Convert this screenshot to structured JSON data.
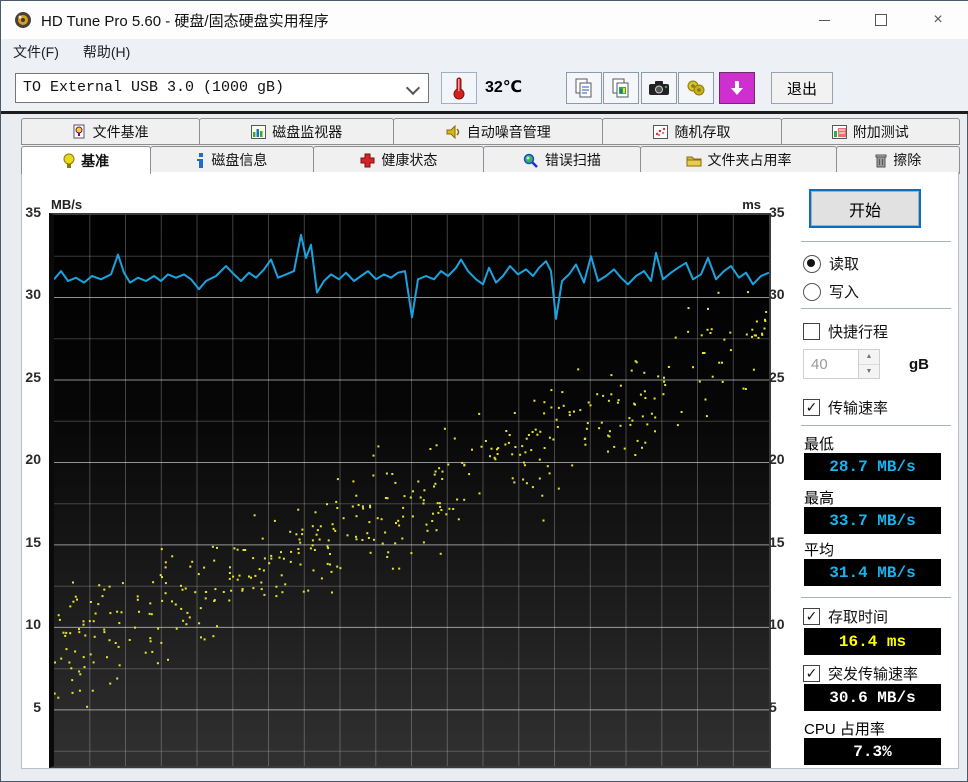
{
  "window": {
    "title": "HD Tune Pro 5.60 - 硬盘/固态硬盘实用程序",
    "controls": [
      "minimize",
      "maximize",
      "close"
    ]
  },
  "menu": {
    "items": [
      "文件(F)",
      "帮助(H)"
    ]
  },
  "toolbar": {
    "drive_select": "TO External USB 3.0 (1000 gB)",
    "temperature": "32℃",
    "buttons": [
      "copy-text-icon",
      "copy-image-icon",
      "screenshot-icon",
      "acoustic-icon",
      "save-results-icon"
    ],
    "exit_label": "退出"
  },
  "tabs": {
    "row1": [
      {
        "label": "文件基准",
        "icon": "file-benchmark-icon"
      },
      {
        "label": "磁盘监视器",
        "icon": "disk-monitor-icon"
      },
      {
        "label": "自动噪音管理",
        "icon": "acoustic-management-icon"
      },
      {
        "label": "随机存取",
        "icon": "random-access-icon"
      },
      {
        "label": "附加测试",
        "icon": "extra-tests-icon"
      }
    ],
    "row2": [
      {
        "label": "基准",
        "icon": "lightbulb-icon",
        "active": true
      },
      {
        "label": "磁盘信息",
        "icon": "info-icon",
        "active": false
      },
      {
        "label": "健康状态",
        "icon": "health-icon",
        "active": false
      },
      {
        "label": "错误扫描",
        "icon": "error-scan-icon",
        "active": false
      },
      {
        "label": "文件夹占用率",
        "icon": "folder-usage-icon",
        "active": false
      },
      {
        "label": "擦除",
        "icon": "erase-icon",
        "active": false
      }
    ]
  },
  "chart_data": {
    "type": "line",
    "y_axis_left_label": "MB/s",
    "y_axis_right_label": "ms",
    "yticks": [
      35,
      30,
      25,
      20,
      15,
      10,
      5
    ],
    "y_top": 35,
    "y_bottom": 1.6,
    "minor_step": 2.5,
    "grid_cols": 20,
    "line_color": "#1ba3e0",
    "dot_color": "#e6e62e",
    "transfer_line_points": [
      [
        0,
        31.1
      ],
      [
        7,
        31.6
      ],
      [
        14,
        31.0
      ],
      [
        22,
        31.2
      ],
      [
        30,
        30.9
      ],
      [
        38,
        31.3
      ],
      [
        47,
        31.1
      ],
      [
        57,
        31.4
      ],
      [
        64,
        32.6
      ],
      [
        70,
        31.5
      ],
      [
        76,
        30.9
      ],
      [
        84,
        31.2
      ],
      [
        92,
        31.0
      ],
      [
        100,
        31.3
      ],
      [
        107,
        31.0
      ],
      [
        114,
        31.4
      ],
      [
        122,
        31.2
      ],
      [
        130,
        31.4
      ],
      [
        137,
        31.1
      ],
      [
        145,
        30.5
      ],
      [
        152,
        31.0
      ],
      [
        162,
        31.3
      ],
      [
        172,
        31.9
      ],
      [
        180,
        31.4
      ],
      [
        187,
        31.0
      ],
      [
        195,
        31.5
      ],
      [
        202,
        31.2
      ],
      [
        210,
        31.7
      ],
      [
        217,
        32.3
      ],
      [
        224,
        31.2
      ],
      [
        232,
        31.4
      ],
      [
        240,
        31.6
      ],
      [
        247,
        33.8
      ],
      [
        252,
        32.4
      ],
      [
        257,
        33.2
      ],
      [
        263,
        30.3
      ],
      [
        270,
        31.0
      ],
      [
        277,
        31.4
      ],
      [
        285,
        31.1
      ],
      [
        292,
        31.5
      ],
      [
        300,
        31.0
      ],
      [
        307,
        31.3
      ],
      [
        314,
        31.6
      ],
      [
        322,
        31.1
      ],
      [
        330,
        31.4
      ],
      [
        337,
        31.2
      ],
      [
        344,
        31.5
      ],
      [
        351,
        31.6
      ],
      [
        358,
        28.8
      ],
      [
        364,
        31.1
      ],
      [
        372,
        31.3
      ],
      [
        380,
        31.1
      ],
      [
        387,
        31.6
      ],
      [
        394,
        31.3
      ],
      [
        402,
        31.8
      ],
      [
        407,
        32.3
      ],
      [
        414,
        31.6
      ],
      [
        422,
        31.1
      ],
      [
        429,
        30.8
      ],
      [
        435,
        31.8
      ],
      [
        442,
        30.9
      ],
      [
        449,
        31.3
      ],
      [
        456,
        31.9
      ],
      [
        464,
        31.4
      ],
      [
        472,
        31.7
      ],
      [
        479,
        31.3
      ],
      [
        485,
        31.8
      ],
      [
        492,
        32.2
      ],
      [
        497,
        31.6
      ],
      [
        502,
        28.7
      ],
      [
        508,
        31.0
      ],
      [
        515,
        31.4
      ],
      [
        522,
        32.0
      ],
      [
        530,
        30.9
      ],
      [
        537,
        32.5
      ],
      [
        544,
        31.0
      ],
      [
        552,
        31.3
      ],
      [
        560,
        31.7
      ],
      [
        567,
        31.2
      ],
      [
        574,
        30.8
      ],
      [
        582,
        31.3
      ],
      [
        590,
        31.6
      ],
      [
        597,
        31.0
      ],
      [
        602,
        32.7
      ],
      [
        609,
        31.1
      ],
      [
        617,
        31.5
      ],
      [
        624,
        31.8
      ],
      [
        632,
        32.1
      ],
      [
        639,
        31.1
      ],
      [
        647,
        31.4
      ],
      [
        654,
        32.4
      ],
      [
        662,
        31.1
      ],
      [
        670,
        31.6
      ],
      [
        677,
        31.9
      ],
      [
        685,
        31.2
      ],
      [
        692,
        31.5
      ],
      [
        699,
        30.8
      ],
      [
        707,
        31.3
      ],
      [
        715,
        31.5
      ]
    ],
    "access_time_scatter": {
      "count": 440,
      "seed": 9,
      "x_bias": 1.18,
      "v_start": 8.0,
      "v_end": 27.6,
      "spread": 3.4,
      "v_min": 2.4,
      "v_max": 30.4
    },
    "stats": {
      "min_mbs": 28.7,
      "max_mbs": 33.7,
      "avg_mbs": 31.4,
      "access_ms": 16.4,
      "burst_mbs": 30.6,
      "cpu_pct": 7.3
    }
  },
  "panel": {
    "start_label": "开始",
    "read_label": "读取",
    "write_label": "写入",
    "shortstroke_label": "快捷行程",
    "shortstroke_value": "40",
    "shortstroke_unit": "gB",
    "transfer_label": "传输速率",
    "min_label": "最低",
    "min_value": "28.7 MB/s",
    "max_label": "最高",
    "max_value": "33.7 MB/s",
    "avg_label": "平均",
    "avg_value": "31.4 MB/s",
    "access_label": "存取时间",
    "access_value": "16.4 ms",
    "burst_label": "突发传输速率",
    "burst_value": "30.6 MB/s",
    "cpu_label": "CPU 占用率",
    "cpu_value": "7.3%"
  }
}
